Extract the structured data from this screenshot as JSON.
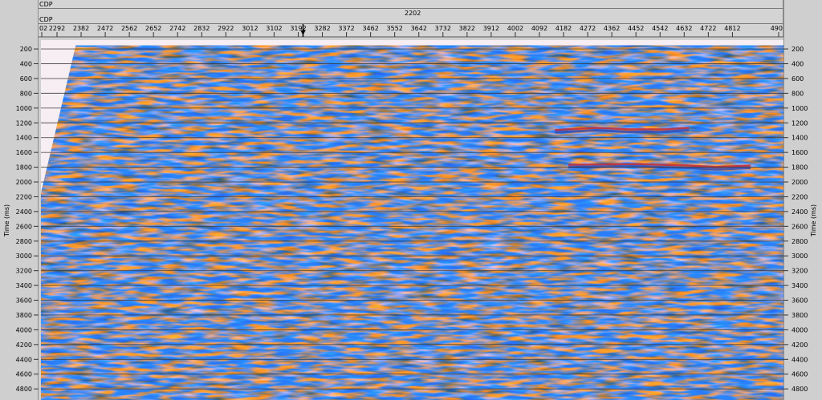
{
  "header": {
    "row1_label": "CDP",
    "row2_label": "CDP",
    "center_value": "2202"
  },
  "chart_data": {
    "type": "heatmap",
    "description_units": "CDP vs two-way time",
    "xlabel": "CDP",
    "ylabel": "Time (ms)",
    "y2label": "Time (ms)",
    "x_tick_labels": [
      "02",
      "2292",
      "2382",
      "2472",
      "2562",
      "2652",
      "2742",
      "2832",
      "2922",
      "3012",
      "3102",
      "3192",
      "3282",
      "3372",
      "3462",
      "3552",
      "3642",
      "3732",
      "3822",
      "3912",
      "4002",
      "4092",
      "4182",
      "4272",
      "4362",
      "4452",
      "4542",
      "4632",
      "4722",
      "4812",
      "490"
    ],
    "x_first_full_tick": 2292,
    "x_tick_step": 90,
    "cursor_x": 3210,
    "y_left_ticks": [
      200,
      400,
      600,
      800,
      1000,
      1200,
      1400,
      1600,
      1800,
      2000,
      2200,
      2400,
      2600,
      2800,
      3000,
      3200,
      3400,
      3600,
      3800,
      4000,
      4200,
      4400,
      4600,
      4800
    ],
    "y_right_ticks": [
      200,
      400,
      600,
      800,
      1000,
      1200,
      1400,
      1600,
      1800,
      2000,
      2200,
      2400,
      2600,
      2800,
      3000,
      3200,
      3400,
      3600,
      3800,
      4000,
      4200,
      4400,
      4600,
      4800
    ],
    "ylim": [
      80,
      4950
    ],
    "y_reversed": true,
    "grid": "horizontal",
    "colors": {
      "background": "#e7cfdc",
      "positive": "#c0303c",
      "negative": "#3a4cae",
      "mid": "#b87aa8",
      "gridline": "#3a3a3a",
      "mute": "#f6eef2"
    },
    "reflectors": [
      {
        "name": "strong reflector",
        "time_ms": [
          1800,
          1790,
          1810,
          1830,
          1810
        ],
        "cdp": [
          4200,
          4450,
          4650,
          4750,
          4880
        ]
      },
      {
        "name": "upper reflector",
        "time_ms": [
          1330,
          1300,
          1320,
          1320,
          1300
        ],
        "cdp": [
          4150,
          4300,
          4420,
          4560,
          4650
        ]
      }
    ]
  }
}
